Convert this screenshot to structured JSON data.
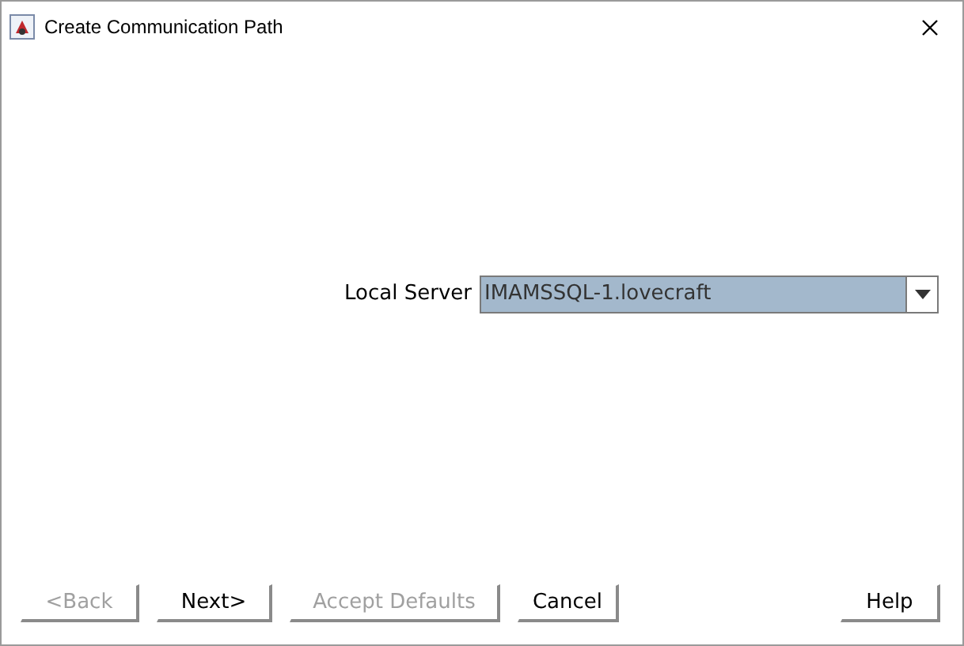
{
  "window": {
    "title": "Create Communication Path"
  },
  "field": {
    "label": "Local Server",
    "value": "IMAMSSQL-1.lovecraft"
  },
  "buttons": [
    {
      "label": "<Back",
      "disabled": true
    },
    {
      "label": "Next>",
      "disabled": false
    },
    {
      "label": "Accept Defaults",
      "disabled": true
    },
    {
      "label": "Cancel",
      "disabled": false
    }
  ],
  "help_button": {
    "label": "Help",
    "disabled": false
  }
}
